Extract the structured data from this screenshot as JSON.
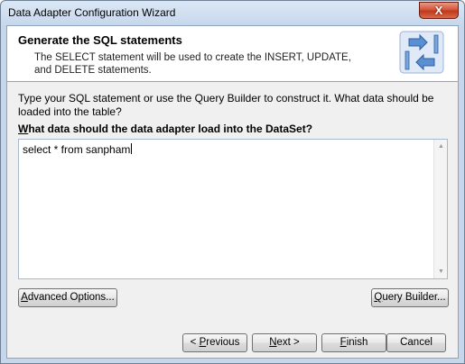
{
  "window": {
    "title": "Data Adapter Configuration Wizard",
    "close_glyph": "X"
  },
  "header": {
    "title": "Generate the SQL statements",
    "description": "The SELECT statement will be used to create the INSERT, UPDATE, and DELETE statements.",
    "icon": "sql-table-arrows-icon"
  },
  "body": {
    "instructions": "Type your SQL statement or use the Query Builder to construct it. What data should be loaded into the table?",
    "question_mnemonic": "W",
    "question_rest": "hat data should the data adapter load into the DataSet?",
    "sql_value": "select * from sanpham"
  },
  "buttons": {
    "advanced": {
      "mnemonic": "A",
      "rest": "dvanced Options..."
    },
    "query_builder": {
      "mnemonic": "Q",
      "rest": "uery Builder..."
    },
    "previous": {
      "prefix": "< ",
      "mnemonic": "P",
      "rest": "revious"
    },
    "next": {
      "mnemonic": "N",
      "rest": "ext >"
    },
    "finish": {
      "mnemonic": "F",
      "rest": "inish"
    },
    "cancel": {
      "label": "Cancel"
    }
  },
  "colors": {
    "frame": "#c6d7ec",
    "close_button": "#c1391c",
    "header_bg": "#ffffff",
    "dialog_bg": "#f0f0f0"
  }
}
